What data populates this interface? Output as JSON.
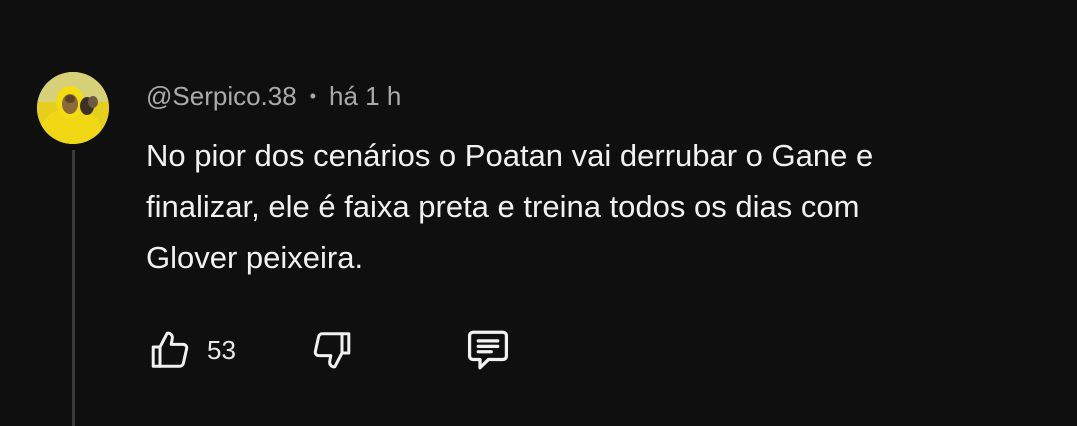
{
  "comment": {
    "author": "@Serpico.38",
    "separator": "•",
    "timestamp": "há 1 h",
    "text_lines": [
      "No pior dos cenários o Poatan vai derrubar o Gane e",
      "finalizar, ele é faixa preta e treina todos os dias com",
      "Glover peixeira."
    ],
    "avatar": {
      "description_icon": "avatar-yellow-hoodie",
      "color": "#d9c21a"
    }
  },
  "actions": {
    "like_count": "53",
    "like_icon": "thumbs-up-icon",
    "dislike_icon": "thumbs-down-icon",
    "reply_icon": "comment-bubble-icon"
  },
  "colors": {
    "background": "#0f0f0f",
    "text_primary": "#f1f1f1",
    "text_secondary": "#aaaaaa",
    "thread_line": "#3a3a3a"
  }
}
